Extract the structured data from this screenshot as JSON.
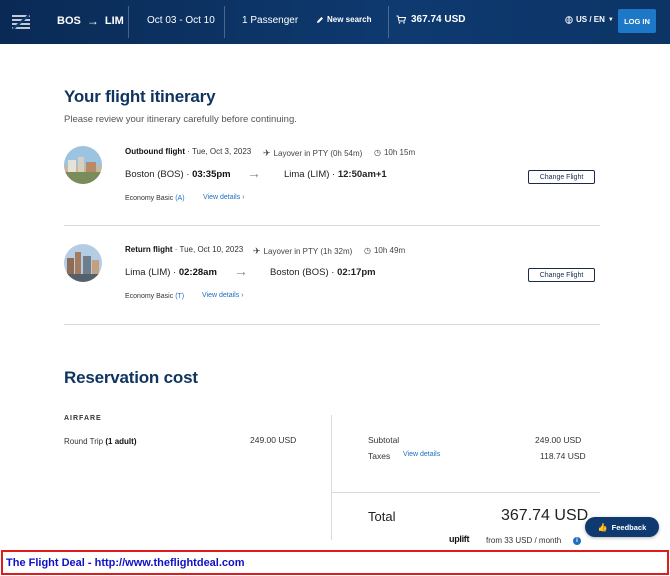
{
  "header": {
    "origin": "BOS",
    "destination": "LIM",
    "dates": "Oct 03 - Oct 10",
    "passengers": "1 Passenger",
    "new_search": "New search",
    "cart_total": "367.74 USD",
    "language": "US / EN",
    "login": "LOG IN"
  },
  "itinerary": {
    "title": "Your flight itinerary",
    "subtitle": "Please review your itinerary carefully before continuing.",
    "flights": [
      {
        "heading": "Outbound flight",
        "date": "Tue, Oct 3, 2023",
        "layover": "Layover in PTY (0h 54m)",
        "duration": "10h 15m",
        "from_city": "Boston (BOS)",
        "from_time": "03:35pm",
        "to_city": "Lima (LIM)",
        "to_time": "12:50am+1",
        "fare_class": "Economy Basic",
        "fare_code": "(A)",
        "view_details": "View details",
        "change_button": "Change Flight"
      },
      {
        "heading": "Return flight",
        "date": "Tue, Oct 10, 2023",
        "layover": "Layover in PTY (1h 32m)",
        "duration": "10h 49m",
        "from_city": "Lima (LIM)",
        "from_time": "02:28am",
        "to_city": "Boston (BOS)",
        "to_time": "02:17pm",
        "fare_class": "Economy Basic",
        "fare_code": "(T)",
        "view_details": "View details",
        "change_button": "Change Flight"
      }
    ]
  },
  "cost": {
    "title": "Reservation cost",
    "airfare_label": "AIRFARE",
    "trip_type": "Round Trip",
    "travelers": "(1 adult)",
    "airfare_amount": "249.00 USD",
    "subtotal_label": "Subtotal",
    "subtotal_amount": "249.00 USD",
    "taxes_label": "Taxes",
    "taxes_link": "View details",
    "taxes_amount": "118.74 USD",
    "total_label": "Total",
    "total_amount": "367.74 USD",
    "uplift_brand": "uplift",
    "uplift_text": "from 33 USD  / month"
  },
  "feedback_button": "Feedback",
  "banner": "The Flight Deal - http://www.theflightdeal.com",
  "colors": {
    "header_bg": "#0e3a70",
    "heading": "#10345f",
    "link": "#1e6fc0",
    "banner_border": "#e01b1b",
    "banner_text": "#1010c8"
  }
}
